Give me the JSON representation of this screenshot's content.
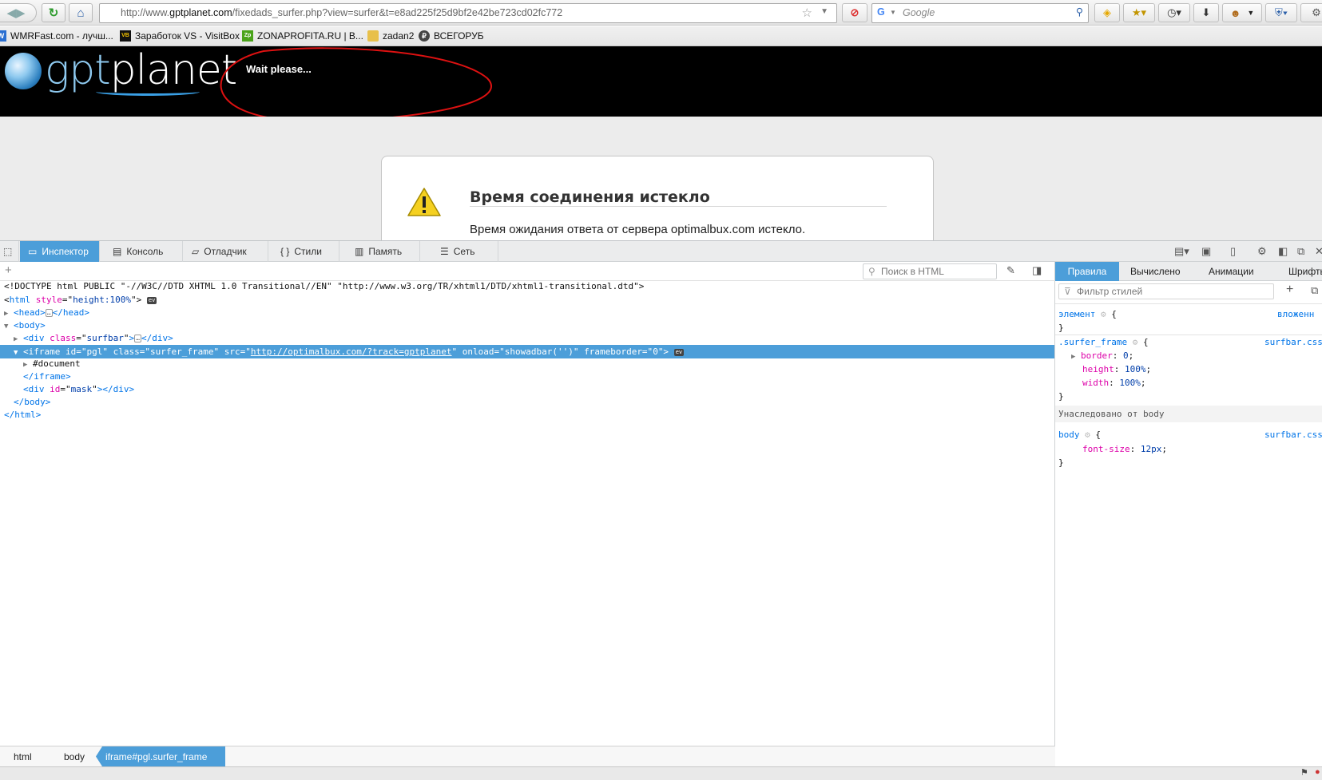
{
  "browser": {
    "url_domain_prefix": "http://www.",
    "url_domain": "gptplanet.com",
    "url_path": "/fixedads_surfer.php?view=surfer&t=e8ad225f25d9bf2e42be723cd02fc772",
    "search_engine": "Google",
    "search_placeholder": "Google"
  },
  "bookmarks": [
    {
      "label": "WMRFast.com - лучш...",
      "icon_color": "#2a6fd1",
      "icon_text": "W"
    },
    {
      "label": "Заработок VS - VisitBox",
      "icon_color": "#111111",
      "icon_text": "VB"
    },
    {
      "label": "ZONAPROFITA.RU | В...",
      "icon_color": "#4aa31a",
      "icon_text": "Zp"
    },
    {
      "label": "zadan2",
      "icon_color": "#e8c04a",
      "icon_text": ""
    },
    {
      "label": "ВСЕГОРУБ",
      "icon_color": "#444444",
      "icon_text": "₽"
    }
  ],
  "page": {
    "logo_text_a": "gpt",
    "logo_text_b": "planet",
    "wait_text": "Wait please...",
    "error_title": "Время соединения истекло",
    "error_text": "Время ожидания ответа от сервера optimalbux.com истекло."
  },
  "devtools": {
    "tabs": [
      {
        "label": "Инспектор",
        "icon": "inspector-icon",
        "active": true
      },
      {
        "label": "Консоль",
        "icon": "console-icon"
      },
      {
        "label": "Отладчик",
        "icon": "debugger-icon"
      },
      {
        "label": "Стили",
        "icon": "styles-icon"
      },
      {
        "label": "Память",
        "icon": "memory-icon"
      },
      {
        "label": "Сеть",
        "icon": "network-icon"
      }
    ],
    "search_html_placeholder": "Поиск в HTML",
    "markup": {
      "doctype": "<!DOCTYPE html PUBLIC \"-//W3C//DTD XHTML 1.0 Transitional//EN\" \"http://www.w3.org/TR/xhtml1/DTD/xhtml1-transitional.dtd\">",
      "html_open_tag": "html",
      "html_style_attr": "style",
      "html_style_val": "height:100%",
      "head_tag": "head",
      "body_tag": "body",
      "div_surfbar_class": "surfbar",
      "iframe_id": "pgl",
      "iframe_class": "surfer_frame",
      "iframe_src": "http://optimalbux.com/?track=gptplanet",
      "iframe_onload": "showadbar('')",
      "iframe_frameborder": "0",
      "document_node": "#document",
      "mask_id": "mask"
    },
    "breadcrumbs": [
      "html",
      "body",
      "iframe#pgl.surfer_frame"
    ],
    "rules_tabs": [
      "Правила",
      "Вычислено",
      "Анимации",
      "Шрифты"
    ],
    "filter_placeholder": "Фильтр стилей",
    "rules": {
      "element_selector": "элемент",
      "element_source": "вложенн",
      "surfer_selector": ".surfer_frame",
      "surfer_source": "surfbar.css",
      "decls": [
        {
          "prop": "border",
          "value": "0"
        },
        {
          "prop": "height",
          "value": "100%"
        },
        {
          "prop": "width",
          "value": "100%"
        }
      ],
      "inherited_label": "Унаследовано от body",
      "body_selector": "body",
      "body_source": "surfbar.css",
      "body_decl_prop": "font-size",
      "body_decl_value": "12px"
    }
  }
}
